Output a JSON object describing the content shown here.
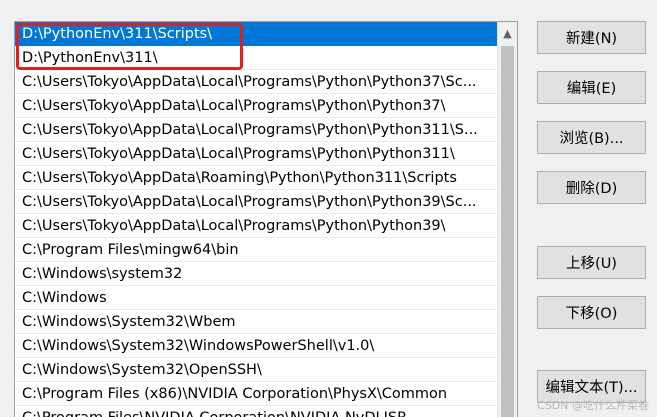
{
  "path_list": {
    "items": [
      "D:\\PythonEnv\\311\\Scripts\\",
      "D:\\PythonEnv\\311\\",
      "C:\\Users\\Tokyo\\AppData\\Local\\Programs\\Python\\Python37\\Sc...",
      "C:\\Users\\Tokyo\\AppData\\Local\\Programs\\Python\\Python37\\",
      "C:\\Users\\Tokyo\\AppData\\Local\\Programs\\Python\\Python311\\S...",
      "C:\\Users\\Tokyo\\AppData\\Local\\Programs\\Python\\Python311\\",
      "C:\\Users\\Tokyo\\AppData\\Roaming\\Python\\Python311\\Scripts",
      "C:\\Users\\Tokyo\\AppData\\Local\\Programs\\Python\\Python39\\Sc...",
      "C:\\Users\\Tokyo\\AppData\\Local\\Programs\\Python\\Python39\\",
      "C:\\Program Files\\mingw64\\bin",
      "C:\\Windows\\system32",
      "C:\\Windows",
      "C:\\Windows\\System32\\Wbem",
      "C:\\Windows\\System32\\WindowsPowerShell\\v1.0\\",
      "C:\\Windows\\System32\\OpenSSH\\",
      "C:\\Program Files (x86)\\NVIDIA Corporation\\PhysX\\Common",
      "C:\\Program Files\\NVIDIA Corporation\\NVIDIA NvDLISR"
    ],
    "selected_index": 0
  },
  "buttons": {
    "new": "新建(N)",
    "edit": "编辑(E)",
    "browse": "浏览(B)...",
    "delete": "删除(D)",
    "move_up": "上移(U)",
    "move_down": "下移(O)",
    "edit_text": "编辑文本(T)..."
  },
  "watermark": "CSDN @吃什么芹菜卷",
  "colors": {
    "selection": "#0078d7",
    "highlight_border": "#e02020"
  }
}
